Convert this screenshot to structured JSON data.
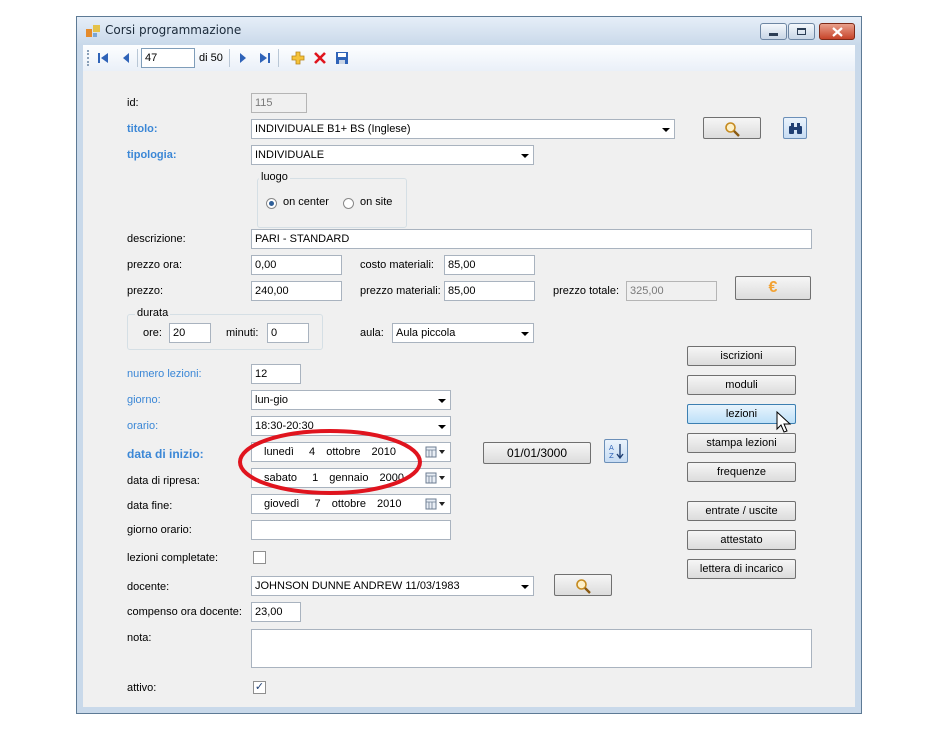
{
  "window": {
    "title": "Corsi programmazione"
  },
  "navigator": {
    "position": "47",
    "count": "di 50"
  },
  "form": {
    "id": {
      "label": "id:",
      "value": "115"
    },
    "titolo": {
      "label": "titolo:",
      "value": "INDIVIDUALE B1+ BS (Inglese)"
    },
    "tipologia": {
      "label": "tipologia:",
      "value": "INDIVIDUALE"
    },
    "luogo": {
      "label": "luogo",
      "option1": "on center",
      "option2": "on site",
      "selected": "on center"
    },
    "descrizione": {
      "label": "descrizione:",
      "value": "PARI - STANDARD"
    },
    "prezzo_ora": {
      "label": "prezzo ora:",
      "value": "0,00"
    },
    "costo_materiali": {
      "label": "costo materiali:",
      "value": "85,00"
    },
    "prezzo": {
      "label": "prezzo:",
      "value": "240,00"
    },
    "prezzo_materiali": {
      "label": "prezzo materiali:",
      "value": "85,00"
    },
    "prezzo_totale": {
      "label": "prezzo totale:",
      "value": "325,00"
    },
    "durata": {
      "label": "durata",
      "ore_label": "ore:",
      "ore": "20",
      "minuti_label": "minuti:",
      "minuti": "0"
    },
    "aula": {
      "label": "aula:",
      "value": "Aula piccola"
    },
    "numero_lezioni": {
      "label": "numero lezioni:",
      "value": "12"
    },
    "giorno": {
      "label": "giorno:",
      "value": "lun-gio"
    },
    "orario": {
      "label": "orario:",
      "value": "18:30-20:30"
    },
    "data_inizio": {
      "label": "data di inizio:",
      "day": "lunedì",
      "date": "4",
      "month": "ottobre",
      "year": "2010"
    },
    "data_ripresa": {
      "label": "data di ripresa:",
      "day": "sabato",
      "date": "1",
      "month": "gennaio",
      "year": "2000"
    },
    "data_fine": {
      "label": "data fine:",
      "day": "giovedì",
      "date": "7",
      "month": "ottobre",
      "year": "2010"
    },
    "date_button": "01/01/3000",
    "giorno_orario": {
      "label": "giorno orario:",
      "value": ""
    },
    "lezioni_completate": {
      "label": "lezioni completate:",
      "checked": false
    },
    "docente": {
      "label": "docente:",
      "value": "JOHNSON DUNNE ANDREW 11/03/1983"
    },
    "compenso": {
      "label": "compenso ora docente:",
      "value": "23,00"
    },
    "nota": {
      "label": "nota:",
      "value": ""
    },
    "attivo": {
      "label": "attivo:",
      "checked": true,
      "mark": "✓"
    }
  },
  "side_buttons": {
    "iscrizioni": "iscrizioni",
    "moduli": "moduli",
    "lezioni": "lezioni",
    "stampa_lezioni": "stampa lezioni",
    "frequenze": "frequenze",
    "entrate_uscite": "entrate / uscite",
    "attestato": "attestato",
    "lettera": "lettera di incarico"
  },
  "euro_symbol": "€",
  "colors": {
    "label_blue": "#3b87d6",
    "highlight_red": "#e0141e",
    "icon_blue": "#2f63b8",
    "euro_orange": "#f2a233"
  }
}
